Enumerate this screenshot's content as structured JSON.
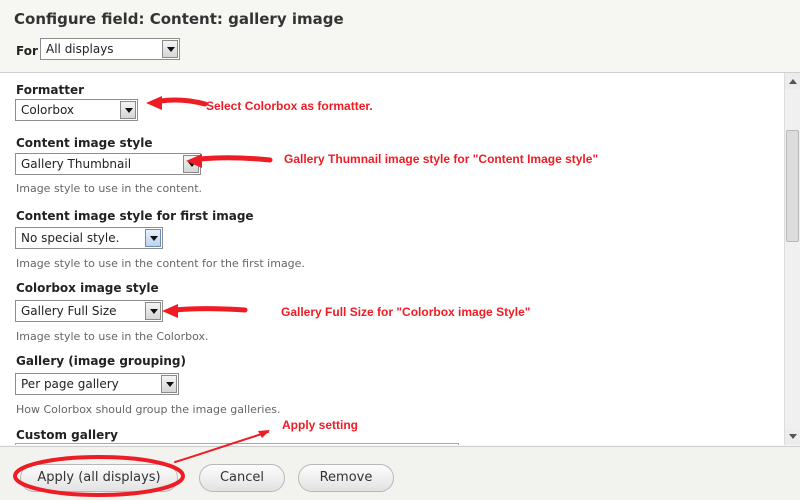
{
  "dialog": {
    "title": "Configure field: Content: gallery image",
    "for_label": "For",
    "for_value": "All displays"
  },
  "form": {
    "formatter": {
      "label": "Formatter",
      "value": "Colorbox"
    },
    "content_image_style": {
      "label": "Content image style",
      "value": "Gallery Thumbnail",
      "description": "Image style to use in the content."
    },
    "first_image_style": {
      "label": "Content image style for first image",
      "value": "No special style.",
      "description": "Image style to use in the content for the first image."
    },
    "colorbox_image_style": {
      "label": "Colorbox image style",
      "value": "Gallery Full Size",
      "description": "Image style to use in the Colorbox."
    },
    "gallery": {
      "label": "Gallery (image grouping)",
      "value": "Per page gallery",
      "description": "How Colorbox should group the image galleries."
    },
    "custom_gallery": {
      "label": "Custom gallery",
      "value": ""
    }
  },
  "footer": {
    "apply_label": "Apply (all displays)",
    "cancel_label": "Cancel",
    "remove_label": "Remove"
  },
  "annotations": {
    "formatter_note": "Select Colorbox as formatter.",
    "content_style_note": "Gallery Thumnail image style for \"Content Image style\"",
    "colorbox_style_note": "Gallery Full Size for \"Colorbox image Style\"",
    "apply_note": "Apply setting",
    "color": "#ee1c24"
  },
  "icons": {
    "dropdown": "chevron-down-icon",
    "scroll_up": "scroll-up-icon",
    "scroll_down": "scroll-down-icon"
  }
}
